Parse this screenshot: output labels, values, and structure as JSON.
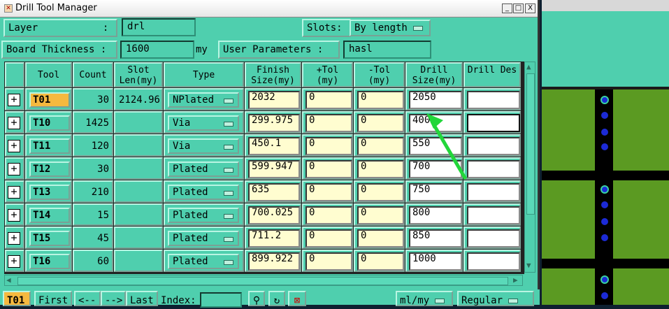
{
  "window": {
    "title": "Drill Tool Manager",
    "minimize": "_",
    "maximize": "□",
    "close": "X"
  },
  "header": {
    "layer_label": "Layer           :",
    "layer_value": "drl",
    "slots_label": "Slots:",
    "slots_value": "By length",
    "thickness_label": "Board Thickness :",
    "thickness_value": "1600",
    "thickness_unit": "my",
    "user_params_label": "User Parameters :",
    "user_params_value": "hasl"
  },
  "table": {
    "columns": [
      "Tool",
      "Count",
      "Slot Len(my)",
      "Type",
      "Finish Size(my)",
      "+Tol (my)",
      "-Tol (my)",
      "Drill Size(my)",
      "Drill Des"
    ],
    "rows": [
      {
        "tool": "T01",
        "count": "30",
        "slot": "2124.96",
        "type": "NPlated",
        "finish": "2032",
        "ptol": "0",
        "ntol": "0",
        "drill": "2050",
        "des": ""
      },
      {
        "tool": "T10",
        "count": "1425",
        "slot": "",
        "type": "Via",
        "finish": "299.975",
        "ptol": "0",
        "ntol": "0",
        "drill": "400",
        "des": ""
      },
      {
        "tool": "T11",
        "count": "120",
        "slot": "",
        "type": "Via",
        "finish": "450.1",
        "ptol": "0",
        "ntol": "0",
        "drill": "550",
        "des": ""
      },
      {
        "tool": "T12",
        "count": "30",
        "slot": "",
        "type": "Plated",
        "finish": "599.947",
        "ptol": "0",
        "ntol": "0",
        "drill": "700",
        "des": ""
      },
      {
        "tool": "T13",
        "count": "210",
        "slot": "",
        "type": "Plated",
        "finish": "635",
        "ptol": "0",
        "ntol": "0",
        "drill": "750",
        "des": ""
      },
      {
        "tool": "T14",
        "count": "15",
        "slot": "",
        "type": "Plated",
        "finish": "700.025",
        "ptol": "0",
        "ntol": "0",
        "drill": "800",
        "des": ""
      },
      {
        "tool": "T15",
        "count": "45",
        "slot": "",
        "type": "Plated",
        "finish": "711.2",
        "ptol": "0",
        "ntol": "0",
        "drill": "850",
        "des": ""
      },
      {
        "tool": "T16",
        "count": "60",
        "slot": "",
        "type": "Plated",
        "finish": "899.922",
        "ptol": "0",
        "ntol": "0",
        "drill": "1000",
        "des": ""
      }
    ]
  },
  "footer": {
    "current_tool": "T01",
    "first": "First",
    "prev": "<--",
    "next": "-->",
    "last": "Last",
    "index_label": "Index:",
    "units": "ml/my",
    "mode": "Regular"
  },
  "icons": {
    "expand": "plus-box-icon",
    "option_menu": "option-menu-icon"
  },
  "colors": {
    "panel": "#4fcfae",
    "selected_tool": "#f6b93f",
    "input_bg": "#fffdd0",
    "annotation_arrow": "#22d63a",
    "board": "#5b9a22"
  }
}
